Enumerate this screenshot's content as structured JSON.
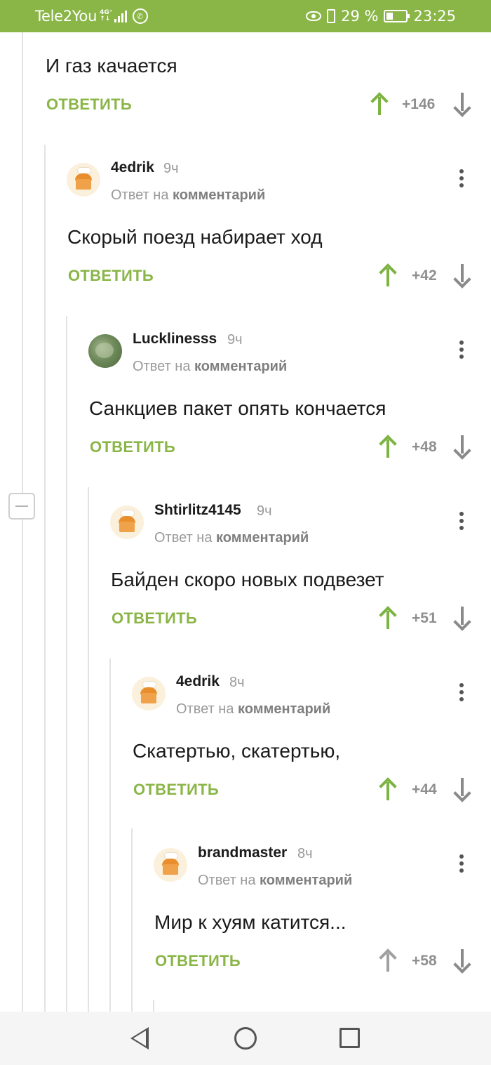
{
  "status_bar": {
    "carrier": "Tele2You",
    "network_top": "4G⁺",
    "network_bottom": "↑↓",
    "battery_percent": "29 %",
    "time": "23:25"
  },
  "top_comment": {
    "text": "И газ качается",
    "reply_label": "ОТВЕТИТЬ",
    "score": "+146"
  },
  "comments": [
    {
      "author": "4edrik",
      "time": "9ч",
      "reply_prefix": "Ответ на",
      "reply_target": "комментарий",
      "text": "Скорый поезд набирает ход",
      "reply_label": "ОТВЕТИТЬ",
      "score": "+42"
    },
    {
      "author": "Lucklinesss",
      "time": "9ч",
      "reply_prefix": "Ответ на",
      "reply_target": "комментарий",
      "text": "Санкциев пакет опять кончается",
      "reply_label": "ОТВЕТИТЬ",
      "score": "+48"
    },
    {
      "author": "Shtirlitz4145",
      "time": "9ч",
      "reply_prefix": "Ответ на",
      "reply_target": "комментарий",
      "text": "Байден скоро новых подвезет",
      "reply_label": "ОТВЕТИТЬ",
      "score": "+51"
    },
    {
      "author": "4edrik",
      "time": "8ч",
      "reply_prefix": "Ответ на",
      "reply_target": "комментарий",
      "text": "Скатертью, скатертью,",
      "reply_label": "ОТВЕТИТЬ",
      "score": "+44"
    },
    {
      "author": "brandmaster",
      "time": "8ч",
      "reply_prefix": "Ответ на",
      "reply_target": "комментарий",
      "text": "Мир к хуям катится...",
      "reply_label": "ОТВЕТИТЬ",
      "score": "+58"
    }
  ],
  "icons": {
    "upvote": "arrow-up-icon",
    "downvote": "arrow-down-icon",
    "menu": "more-vertical-icon",
    "collapse": "minus-icon"
  },
  "colors": {
    "accent": "#8ab547",
    "upvote_active": "#7cb342",
    "muted": "#9a9a9a"
  }
}
